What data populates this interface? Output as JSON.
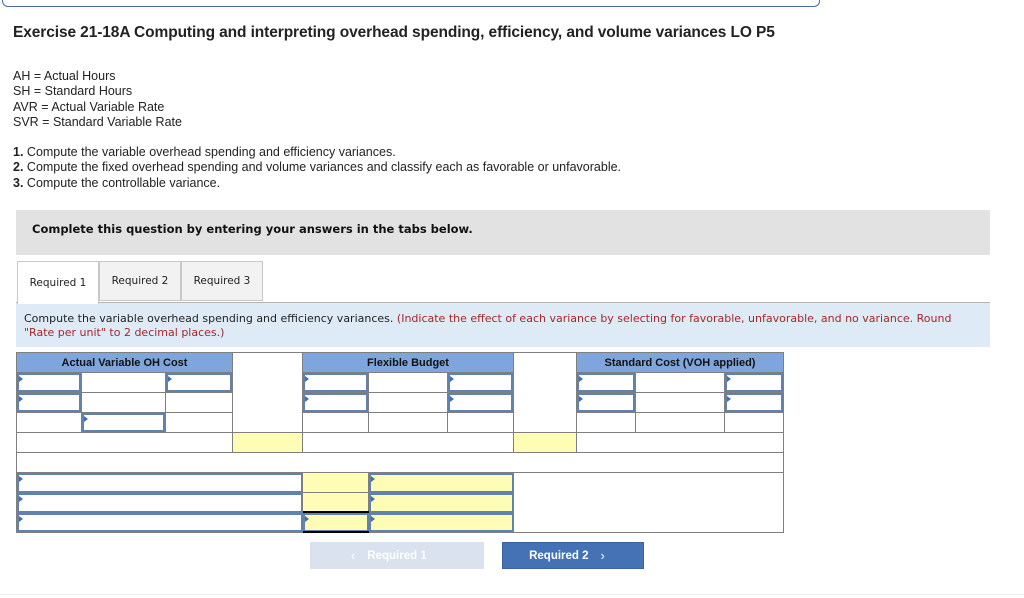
{
  "exercise": {
    "title": "Exercise 21-18A Computing and interpreting overhead spending, efficiency, and volume variances LO P5"
  },
  "definitions": [
    "AH = Actual Hours",
    "SH = Standard Hours",
    "AVR = Actual Variable Rate",
    "SVR = Standard Variable Rate"
  ],
  "requirements": [
    {
      "num": "1.",
      "text": " Compute the variable overhead spending and efficiency variances."
    },
    {
      "num": "2.",
      "text": " Compute the fixed overhead spending and volume variances and classify each as favorable or unfavorable."
    },
    {
      "num": "3.",
      "text": " Compute the controllable variance."
    }
  ],
  "instruction_banner": "Complete this question by entering your answers in the tabs below.",
  "tabs": [
    {
      "label": "Required 1",
      "active": true
    },
    {
      "label": "Required 2",
      "active": false
    },
    {
      "label": "Required 3",
      "active": false
    }
  ],
  "question": {
    "text": "Compute the variable overhead spending and efficiency variances.",
    "note": "(Indicate the effect of each variance by selecting for favorable, unfavorable, and no variance. Round \"Rate per unit\" to 2 decimal places.)"
  },
  "grid": {
    "headers": {
      "actual": "Actual Variable OH Cost",
      "flexible": "Flexible Budget",
      "standard": "Standard Cost (VOH applied)"
    },
    "inputs": {
      "actual_r1_label": "",
      "actual_r1_value": "",
      "actual_r2_label": "",
      "actual_r3_value": "",
      "flex_r1_label": "",
      "flex_r1_value": "",
      "flex_r2_label": "",
      "flex_r2_value": "",
      "std_r1_label": "",
      "std_r1_value": "",
      "std_r2_label": "",
      "std_r2_value": "",
      "summary_r1_label": "",
      "summary_r1_amount": "",
      "summary_r1_effect": "",
      "summary_r2_label": "",
      "summary_r2_amount": "",
      "summary_r2_effect": "",
      "summary_r3_label": "",
      "summary_r3_amount": "",
      "summary_r3_effect": ""
    }
  },
  "nav": {
    "prev_label": "Required 1",
    "next_label": "Required 2",
    "prev_icon": "‹",
    "next_icon": "›"
  },
  "colors": {
    "header_blue": "#7fa6dc",
    "input_yellow": "#fffcb5",
    "note_red": "#a4262c",
    "button_blue": "#4472b4",
    "panel_blue": "#deebf7"
  }
}
